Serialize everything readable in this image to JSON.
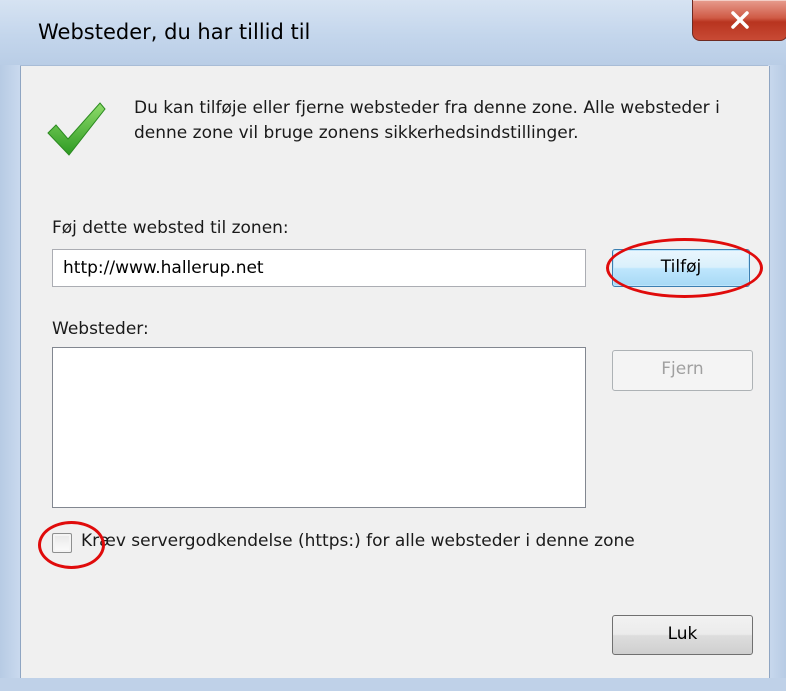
{
  "dialog": {
    "title": "Websteder, du har tillid til",
    "close_glyph": "X"
  },
  "info": {
    "icon": "green-check-icon",
    "text": "Du kan tilføje eller fjerne websteder fra denne zone. Alle websteder i denne zone vil bruge zonens sikkerhedsindstillinger."
  },
  "add_section": {
    "label": "Føj dette websted til zonen:",
    "input_value": "http://www.hallerup.net",
    "add_button": "Tilføj"
  },
  "sites_section": {
    "label": "Websteder:",
    "items": [],
    "remove_button": "Fjern"
  },
  "https_checkbox": {
    "label": "Kræv servergodkendelse (https:) for alle websteder i denne zone",
    "checked": false
  },
  "footer": {
    "close_button": "Luk"
  },
  "colors": {
    "highlight_ring": "#e00b0b",
    "check_green": "#3fae2a",
    "titlebar": "#c4d6ec",
    "close_button": "#c84a35"
  }
}
